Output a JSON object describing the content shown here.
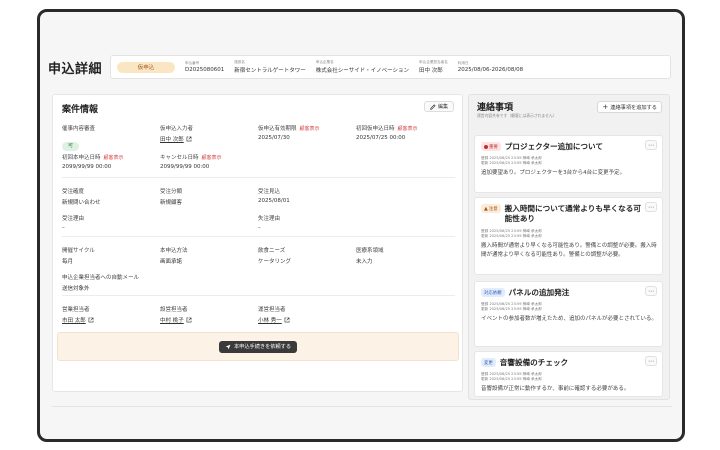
{
  "header": {
    "title": "申込詳細",
    "status": "仮申込",
    "fields": [
      {
        "label": "申込番号",
        "value": "D2025080601"
      },
      {
        "label": "施設名",
        "value": "新宿セントラルゲートタワー"
      },
      {
        "label": "申込企業名",
        "value": "株式会社シーサイド・イノベーション"
      },
      {
        "label": "申込企業担当者名",
        "value": "田中 次郎"
      },
      {
        "label": "利用日",
        "value": "2025/08/06-2026/08/08"
      }
    ]
  },
  "details": {
    "title": "案件情報",
    "edit_label": "編集",
    "review": {
      "label": "催事内容審査",
      "badge": "可"
    },
    "temp_input_by": {
      "label": "仮申込入力者",
      "value": "田中 次郎"
    },
    "temp_expiry": {
      "label": "仮申込有効期限",
      "note": "顧客表示",
      "value": "2025/07/30"
    },
    "first_temp_date": {
      "label": "初回仮申込日時",
      "note": "顧客表示",
      "value": "2025/07/25 00:00"
    },
    "first_main_date": {
      "label": "初回本申込日時",
      "note": "顧客表示",
      "value": "2099/99/99 00:00"
    },
    "cancel_date": {
      "label": "キャンセル日時",
      "note": "顧客表示",
      "value": "2099/99/99 00:00"
    },
    "order_accuracy": {
      "label": "受注確度",
      "value": "新規問い合わせ"
    },
    "order_class": {
      "label": "受注分類",
      "value": "新規顧客"
    },
    "order_forecast": {
      "label": "受注見込",
      "value": "2025/08/01"
    },
    "order_reason": {
      "label": "受注理由",
      "value": "–"
    },
    "lost_reason": {
      "label": "失注理由",
      "value": "–"
    },
    "cycle": {
      "label": "開催サイクル",
      "value": "毎月"
    },
    "main_method": {
      "label": "本申込方法",
      "value": "画面承諾"
    },
    "food_needs": {
      "label": "飲食ニーズ",
      "value": "ケータリング"
    },
    "medical": {
      "label": "医療系領域",
      "value": "未入力"
    },
    "auto_mail": {
      "label": "申込企業担当者への自動メール",
      "value": "送信対象外"
    },
    "sales_rep": {
      "label": "営業担当者",
      "value": "市田 太郎"
    },
    "setup_rep": {
      "label": "設営担当者",
      "value": "中村 桃子"
    },
    "ops_rep": {
      "label": "運営担当者",
      "value": "小林 秀一"
    },
    "cta_label": "本申込手続きを依頼する"
  },
  "contacts": {
    "title": "連絡事項",
    "subtitle": "運営内容共有です（顧客には表示されません）",
    "add_label": "連絡事項を追加する",
    "items": [
      {
        "tag": "重要",
        "tag_kind": "urgent",
        "title": "プロジェクター追加について",
        "registered": "登録 2025/06/25 23:59 神崎 承太郎",
        "updated": "更新 2025/06/25 23:59 神崎 承太郎",
        "body": "追加要望あり。プロジェクターを3台から4台に変更予定。"
      },
      {
        "tag": "注意",
        "tag_kind": "caution",
        "title": "搬入時間について通常よりも早くなる可能性あり",
        "registered": "登録 2025/06/25 23:59 神崎 承太郎",
        "updated": "更新 2025/06/25 23:59 神崎 承太郎",
        "body": "搬入時間が通常より早くなる可能性あり。警備との調整が必要。搬入時間が通常より早くなる可能性あり。警備との調整が必要。"
      },
      {
        "tag": "対応依頼",
        "tag_kind": "action",
        "title": "パネルの追加発注",
        "registered": "登録 2025/06/25 23:59 神崎 承太郎",
        "updated": "更新 2025/06/25 23:59 神崎 承太郎",
        "body": "イベントの参加者数が増えたため、追加のパネルが必要とされている。"
      },
      {
        "tag": "変更",
        "tag_kind": "change",
        "title": "音響設備のチェック",
        "registered": "登録 2025/06/25 23:59 神崎 承太郎",
        "updated": "更新 2025/06/25 23:59 神崎 承太郎",
        "body": "音響設備が正常に動作するか、事前に確認する必要がある。"
      }
    ]
  }
}
